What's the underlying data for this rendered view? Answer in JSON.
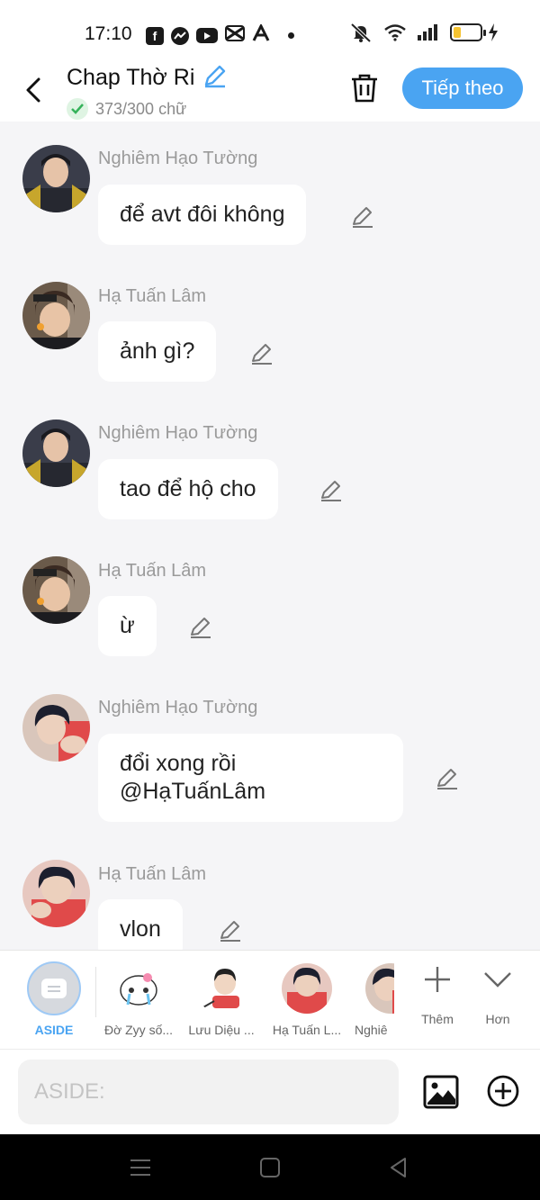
{
  "status_bar": {
    "time": "17:10",
    "app_icons": [
      "facebook-icon",
      "messenger-icon",
      "youtube-icon",
      "capcut-icon",
      "app-a-icon"
    ],
    "battery_level": 0.3,
    "battery_color": "#f5c331"
  },
  "header": {
    "title": "Chap Thờ Ri",
    "counter": "373/300 chữ",
    "next_label": "Tiếp theo",
    "accent": "#4aa4f2"
  },
  "messages": [
    {
      "sender": "Nghiêm Hạo Tường",
      "text": "để avt đôi không"
    },
    {
      "sender": "Hạ Tuấn Lâm",
      "text": "ảnh gì?"
    },
    {
      "sender": "Nghiêm Hạo Tường",
      "text": "tao để hộ cho"
    },
    {
      "sender": "Hạ Tuấn Lâm",
      "text": "ừ"
    },
    {
      "sender": "Nghiêm Hạo Tường",
      "text_line1": "đổi xong rồi",
      "text_line2": "@HạTuấnLâm"
    },
    {
      "sender": "Hạ Tuấn Lâm",
      "text": "vlon"
    }
  ],
  "switcher": {
    "aside_label": "ASIDE",
    "characters": [
      "Đờ Zyy số...",
      "Lưu Diệu ...",
      "Hạ Tuấn L...",
      "Nghiê"
    ],
    "more_label": "Thêm",
    "hon_label": "Hơn"
  },
  "composer": {
    "placeholder": "ASIDE:"
  }
}
